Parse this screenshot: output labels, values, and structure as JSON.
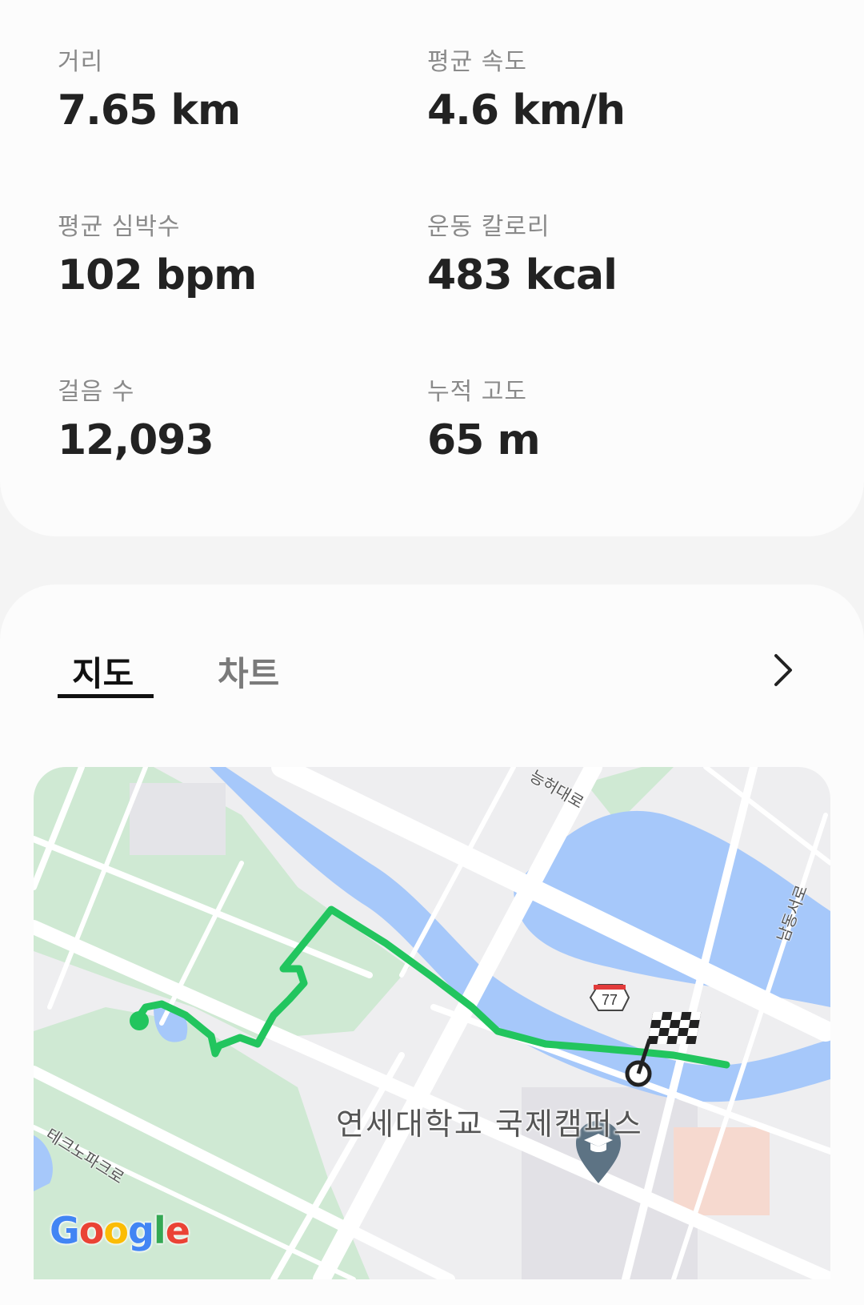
{
  "stats": [
    {
      "label": "거리",
      "value": "7.65 km"
    },
    {
      "label": "평균 속도",
      "value": "4.6 km/h"
    },
    {
      "label": "평균 심박수",
      "value": "102 bpm"
    },
    {
      "label": "운동 칼로리",
      "value": "483 kcal"
    },
    {
      "label": "걸음 수",
      "value": "12,093"
    },
    {
      "label": "누적 고도",
      "value": "65 m"
    }
  ],
  "tabs": {
    "map": "지도",
    "chart": "차트"
  },
  "map": {
    "campus_label": "연세대학교 국제캠퍼스",
    "streets": {
      "top": "능허대로",
      "right": "남동서로",
      "left": "테크노파크로"
    },
    "highway_number": "77",
    "route_color": "#22c55e",
    "water_color": "#a6c8fa",
    "park_color": "#cfe9d3",
    "attribution": "Google"
  },
  "icons": {
    "next": "chevron-right-icon",
    "finish": "checkered-flag-icon",
    "school_pin": "graduation-cap-pin-icon",
    "highway": "highway-shield-icon"
  }
}
